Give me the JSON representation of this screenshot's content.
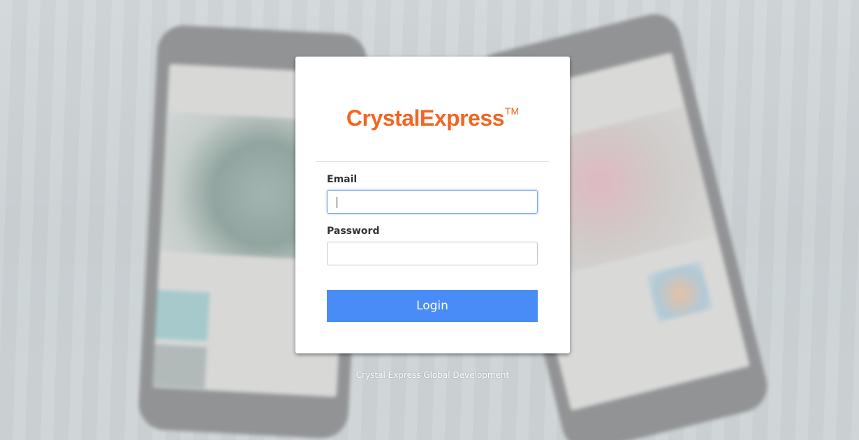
{
  "logo": {
    "brand_text": "CrystalExpress",
    "trademark": "TM",
    "color": "#f26522"
  },
  "form": {
    "email_label": "Email",
    "email_value": "",
    "password_label": "Password",
    "password_value": "",
    "login_label": "Login",
    "button_color": "#4a8cf7"
  },
  "footer": {
    "text": "Crystal Express Global Development"
  }
}
